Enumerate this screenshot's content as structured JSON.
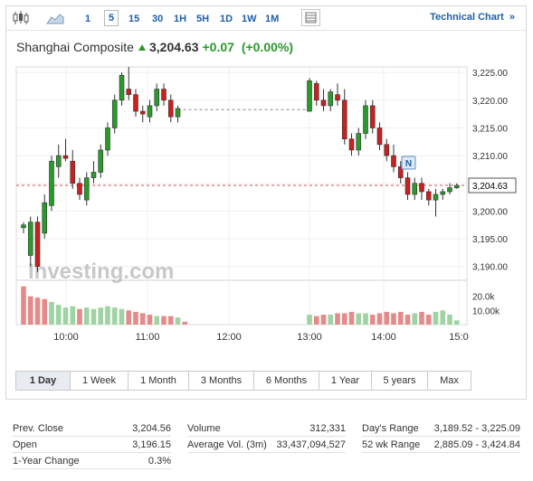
{
  "toolbar": {
    "timeframes": [
      "1",
      "5",
      "15",
      "30",
      "1H",
      "5H",
      "1D",
      "1W",
      "1M"
    ],
    "active_timeframe": "5",
    "tech_chart_label": "Technical Chart",
    "tech_chart_chevron": "»"
  },
  "quote": {
    "name": "Shanghai Composite",
    "price": "3,204.63",
    "change": "+0.07",
    "change_pct": "(+0.00%)",
    "up_color": "#2a9a2a",
    "down_color": "#c92020"
  },
  "chart_data": {
    "type": "candlestick",
    "x_ticks": [
      "10:00",
      "11:00",
      "12:00",
      "13:00",
      "14:00",
      "15:0"
    ],
    "y_ticks": [
      "3,225.00",
      "3,220.00",
      "3,215.00",
      "3,210.00",
      "3,205.00",
      "3,200.00",
      "3,195.00",
      "3,190.00"
    ],
    "ylim": [
      3188,
      3226
    ],
    "last_price_label": "3,204.63",
    "last_price": 3204.63,
    "marker_label": "N",
    "watermark": "Investing.com",
    "volume_ticks": [
      "20.0k",
      "10.00k"
    ],
    "volume_ylim": [
      0,
      30
    ],
    "candles": [
      {
        "o": 3197,
        "h": 3198,
        "l": 3196,
        "c": 3197.5
      },
      {
        "o": 3192,
        "h": 3199,
        "l": 3190,
        "c": 3198
      },
      {
        "o": 3198,
        "h": 3199,
        "l": 3189,
        "c": 3190
      },
      {
        "o": 3196,
        "h": 3203,
        "l": 3195,
        "c": 3201.5
      },
      {
        "o": 3201,
        "h": 3210,
        "l": 3200,
        "c": 3209
      },
      {
        "o": 3208,
        "h": 3212,
        "l": 3206,
        "c": 3210
      },
      {
        "o": 3210,
        "h": 3213,
        "l": 3209,
        "c": 3209.5
      },
      {
        "o": 3209,
        "h": 3211,
        "l": 3204,
        "c": 3205
      },
      {
        "o": 3205,
        "h": 3206,
        "l": 3202,
        "c": 3203
      },
      {
        "o": 3202,
        "h": 3207,
        "l": 3201,
        "c": 3206
      },
      {
        "o": 3206,
        "h": 3209,
        "l": 3205,
        "c": 3207
      },
      {
        "o": 3207,
        "h": 3212,
        "l": 3206,
        "c": 3211
      },
      {
        "o": 3211,
        "h": 3216,
        "l": 3210,
        "c": 3215
      },
      {
        "o": 3215,
        "h": 3221,
        "l": 3214,
        "c": 3220
      },
      {
        "o": 3220,
        "h": 3225,
        "l": 3219,
        "c": 3224.5
      },
      {
        "o": 3222,
        "h": 3226,
        "l": 3220,
        "c": 3221
      },
      {
        "o": 3221,
        "h": 3222,
        "l": 3217,
        "c": 3218
      },
      {
        "o": 3218,
        "h": 3219,
        "l": 3216,
        "c": 3217.5
      },
      {
        "o": 3217,
        "h": 3220,
        "l": 3216,
        "c": 3219
      },
      {
        "o": 3219,
        "h": 3223,
        "l": 3218,
        "c": 3222
      },
      {
        "o": 3222,
        "h": 3223,
        "l": 3219,
        "c": 3220
      },
      {
        "o": 3220,
        "h": 3221,
        "l": 3216,
        "c": 3217
      },
      {
        "o": 3217,
        "h": 3219,
        "l": 3216,
        "c": 3218.5
      },
      {
        "o": 3218,
        "h": 3219,
        "l": 3217,
        "c": 3218.3
      },
      {
        "o": 3218,
        "h": 3224,
        "l": 3218,
        "c": 3223.5
      },
      {
        "o": 3223,
        "h": 3223.5,
        "l": 3219,
        "c": 3220
      },
      {
        "o": 3220,
        "h": 3222,
        "l": 3218,
        "c": 3219
      },
      {
        "o": 3219,
        "h": 3222,
        "l": 3218,
        "c": 3221.5
      },
      {
        "o": 3221,
        "h": 3223,
        "l": 3219,
        "c": 3220
      },
      {
        "o": 3220,
        "h": 3222,
        "l": 3212,
        "c": 3213
      },
      {
        "o": 3213,
        "h": 3214,
        "l": 3210,
        "c": 3211
      },
      {
        "o": 3211,
        "h": 3215,
        "l": 3210,
        "c": 3214
      },
      {
        "o": 3214,
        "h": 3220,
        "l": 3213,
        "c": 3219
      },
      {
        "o": 3219,
        "h": 3220,
        "l": 3214,
        "c": 3215
      },
      {
        "o": 3215,
        "h": 3216,
        "l": 3211,
        "c": 3212
      },
      {
        "o": 3212,
        "h": 3213,
        "l": 3209,
        "c": 3210
      },
      {
        "o": 3210,
        "h": 3212,
        "l": 3207,
        "c": 3208
      },
      {
        "o": 3208,
        "h": 3209,
        "l": 3205,
        "c": 3206
      },
      {
        "o": 3206,
        "h": 3207,
        "l": 3202,
        "c": 3203
      },
      {
        "o": 3203,
        "h": 3206,
        "l": 3202,
        "c": 3205
      },
      {
        "o": 3205,
        "h": 3206,
        "l": 3202,
        "c": 3203.5
      },
      {
        "o": 3203.5,
        "h": 3204,
        "l": 3201,
        "c": 3202
      },
      {
        "o": 3202,
        "h": 3204,
        "l": 3199,
        "c": 3203
      },
      {
        "o": 3203,
        "h": 3204,
        "l": 3202,
        "c": 3203.5
      },
      {
        "o": 3203.5,
        "h": 3205,
        "l": 3203,
        "c": 3204.2
      },
      {
        "o": 3204.2,
        "h": 3205,
        "l": 3204,
        "c": 3204.63
      }
    ],
    "volumes": [
      27,
      20,
      19,
      18,
      16,
      14,
      12,
      13,
      11,
      12,
      11,
      12,
      13,
      12,
      11,
      10,
      9,
      8,
      7,
      6,
      6,
      6,
      5,
      2,
      7,
      6,
      7,
      7,
      8,
      8,
      9,
      8,
      8,
      7,
      8,
      9,
      8,
      9,
      7,
      8,
      9,
      7,
      9,
      10,
      7,
      3
    ],
    "volume_colors": [
      "d",
      "d",
      "d",
      "d",
      "u",
      "u",
      "u",
      "u",
      "d",
      "u",
      "u",
      "u",
      "u",
      "u",
      "u",
      "d",
      "d",
      "d",
      "d",
      "u",
      "d",
      "d",
      "u",
      "d",
      "u",
      "d",
      "d",
      "u",
      "d",
      "d",
      "d",
      "u",
      "u",
      "d",
      "d",
      "d",
      "d",
      "d",
      "d",
      "u",
      "d",
      "d",
      "u",
      "u",
      "u",
      "u"
    ]
  },
  "ranges": [
    "1 Day",
    "1 Week",
    "1 Month",
    "3 Months",
    "6 Months",
    "1 Year",
    "5 years",
    "Max"
  ],
  "active_range": "1 Day",
  "stats": {
    "col1": [
      {
        "label": "Prev. Close",
        "value": "3,204.56"
      },
      {
        "label": "Open",
        "value": "3,196.15"
      },
      {
        "label": "1-Year Change",
        "value": "0.3%"
      }
    ],
    "col2": [
      {
        "label": "Volume",
        "value": "312,331"
      },
      {
        "label": "Average Vol. (3m)",
        "value": "33,437,094,527"
      }
    ],
    "col3": [
      {
        "label": "Day's Range",
        "value": "3,189.52 - 3,225.09"
      },
      {
        "label": "52 wk Range",
        "value": "2,885.09 - 3,424.84"
      }
    ]
  }
}
